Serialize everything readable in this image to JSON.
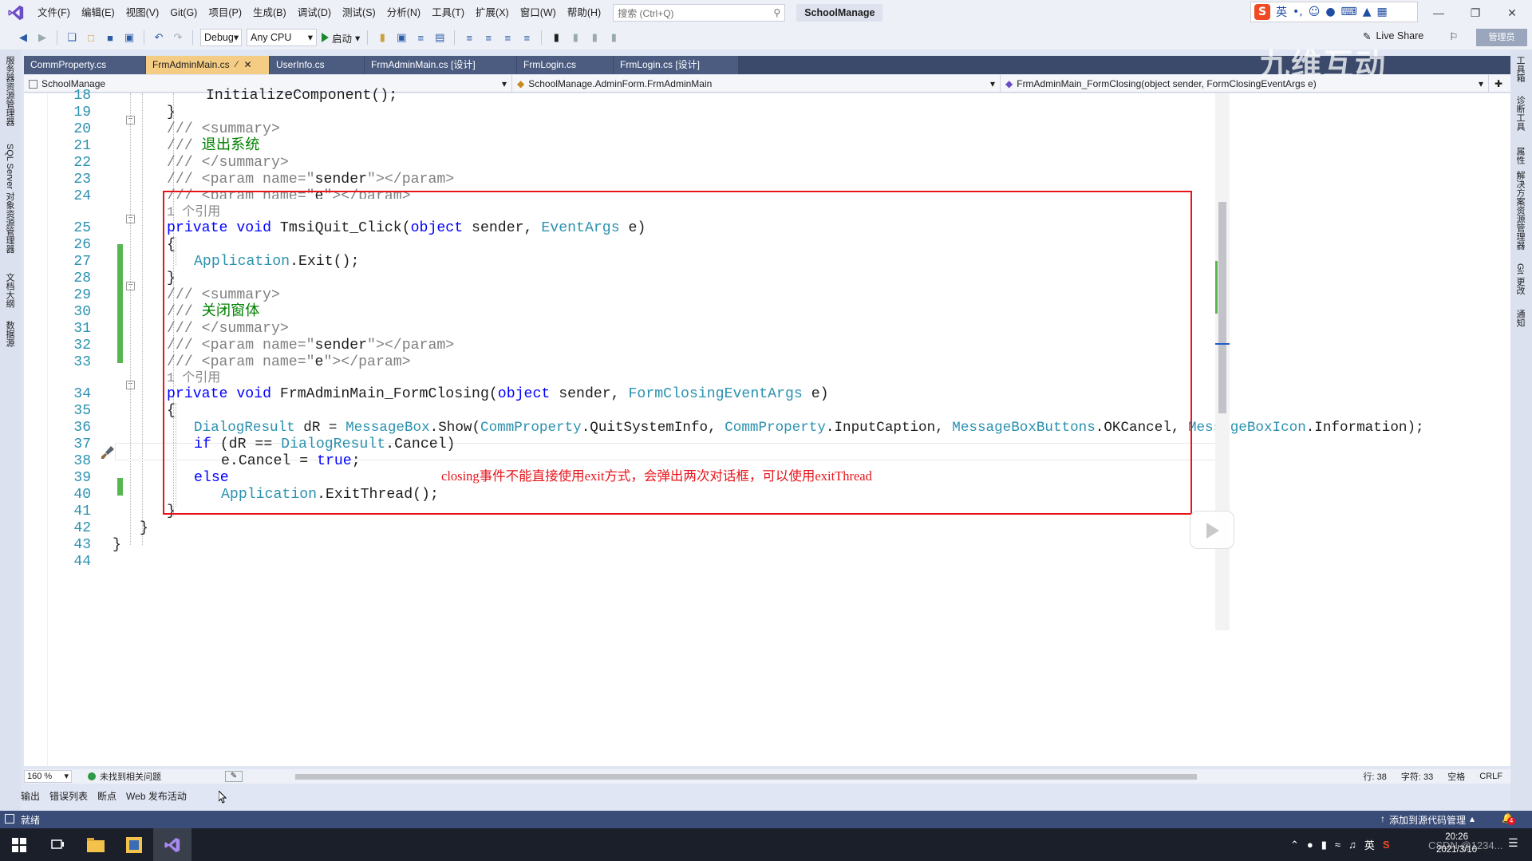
{
  "menubar": {
    "items": [
      "文件(F)",
      "编辑(E)",
      "视图(V)",
      "Git(G)",
      "项目(P)",
      "生成(B)",
      "调试(D)",
      "测试(S)",
      "分析(N)",
      "工具(T)",
      "扩展(X)",
      "窗口(W)",
      "帮助(H)"
    ],
    "search_placeholder": "搜索 (Ctrl+Q)",
    "solution_name": "SchoolManage",
    "ime_lang": "英"
  },
  "toolbar": {
    "config": "Debug",
    "platform": "Any CPU",
    "start_label": "启动",
    "live_share_label": "Live Share",
    "admin_label": "管理员"
  },
  "left_strip": {
    "tabs": [
      "服务器资源管理器",
      "SQL Server 对象资源管理器",
      "文档大纲",
      "数据源"
    ]
  },
  "right_strip": {
    "tabs": [
      "工具箱",
      "诊断工具",
      "属性",
      "解决方案资源管理器",
      "Git 更改",
      "通知"
    ]
  },
  "tabs": [
    {
      "label": "CommProperty.cs",
      "active": false
    },
    {
      "label": "FrmAdminMain.cs",
      "active": true
    },
    {
      "label": "UserInfo.cs",
      "active": false
    },
    {
      "label": "FrmAdminMain.cs [设计]",
      "active": false
    },
    {
      "label": "FrmLogin.cs",
      "active": false
    },
    {
      "label": "FrmLogin.cs [设计]",
      "active": false
    }
  ],
  "watermark_text": "九维互动",
  "navbar": {
    "project": "SchoolManage",
    "class": "SchoolManage.AdminForm.FrmAdminMain",
    "member": "FrmAdminMain_FormClosing(object sender, FormClosingEventArgs e)"
  },
  "editor": {
    "line_numbers": [
      "18",
      "19",
      "20",
      "21",
      "22",
      "23",
      "24",
      "25",
      "26",
      "27",
      "28",
      "29",
      "30",
      "31",
      "32",
      "33",
      "34",
      "35",
      "36",
      "37",
      "38",
      "39",
      "40",
      "41",
      "42",
      "43",
      "44"
    ],
    "codelens_1": "1 个引用",
    "codelens_2": "1 个引用",
    "annotation": "closing事件不能直接使用exit方式，会弹出两次对话框，可以使用exitThread",
    "code": {
      "l18": "InitializeComponent();",
      "l19": "}",
      "l20": "/// <summary>",
      "l21_prefix": "/// ",
      "l21_text": "退出系统",
      "l22": "/// </summary>",
      "l23_prefix": "/// <param name=\"",
      "l23_name": "sender",
      "l23_suffix": "\"></param>",
      "l24_prefix": "/// <param name=\"",
      "l24_name": "e",
      "l24_suffix": "\"></param>",
      "l25_kw1": "private",
      "l25_kw2": "void",
      "l25_name": " TmsiQuit_Click(",
      "l25_kw3": "object",
      "l25_mid": " sender, ",
      "l25_type": "EventArgs",
      "l25_end": " e)",
      "l26": "{",
      "l27_type": "Application",
      "l27_rest": ".Exit();",
      "l28": "}",
      "l29": "/// <summary>",
      "l30_prefix": "/// ",
      "l30_text": "关闭窗体",
      "l31": "/// </summary>",
      "l32_prefix": "/// <param name=\"",
      "l32_name": "sender",
      "l32_suffix": "\"></param>",
      "l33_prefix": "/// <param name=\"",
      "l33_name": "e",
      "l33_suffix": "\"></param>",
      "l34_kw1": "private",
      "l34_kw2": "void",
      "l34_name": " FrmAdminMain_FormClosing(",
      "l34_kw3": "object",
      "l34_mid": " sender, ",
      "l34_type": "FormClosingEventArgs",
      "l34_end": " e)",
      "l35": "{",
      "l36_t1": "DialogResult",
      "l36_a": " dR = ",
      "l36_t2": "MessageBox",
      "l36_b": ".Show(",
      "l36_t3": "CommProperty",
      "l36_c": ".QuitSystemInfo, ",
      "l36_t4": "CommProperty",
      "l36_d": ".InputCaption, ",
      "l36_t5": "MessageBoxButtons",
      "l36_e": ".OKCancel, ",
      "l36_t6": "MessageBoxIcon",
      "l36_f": ".Information);",
      "l37_kw": "if",
      "l37_a": " (dR == ",
      "l37_type": "DialogResult",
      "l37_b": ".Cancel)",
      "l38_a": "e.Cancel = ",
      "l38_kw": "true",
      "l38_b": ";",
      "l39_kw": "else",
      "l40_type": "Application",
      "l40_rest": ".ExitThread();",
      "l41": "}",
      "l42": "}",
      "l43": "}"
    }
  },
  "editor_status": {
    "zoom": "160 %",
    "issues": "未找到相关问题",
    "line": "行: 38",
    "char": "字符: 33",
    "ws": "空格",
    "eol": "CRLF"
  },
  "tool_tabs": [
    "输出",
    "错误列表",
    "断点",
    "Web 发布活动"
  ],
  "statusbar": {
    "ready": "就绪",
    "source_control": "添加到源代码管理",
    "notif_count": "4"
  },
  "taskbar": {
    "time": "20:26",
    "date": "2021/3/10",
    "ime": "英",
    "csdn": "CSDN @1234..."
  }
}
